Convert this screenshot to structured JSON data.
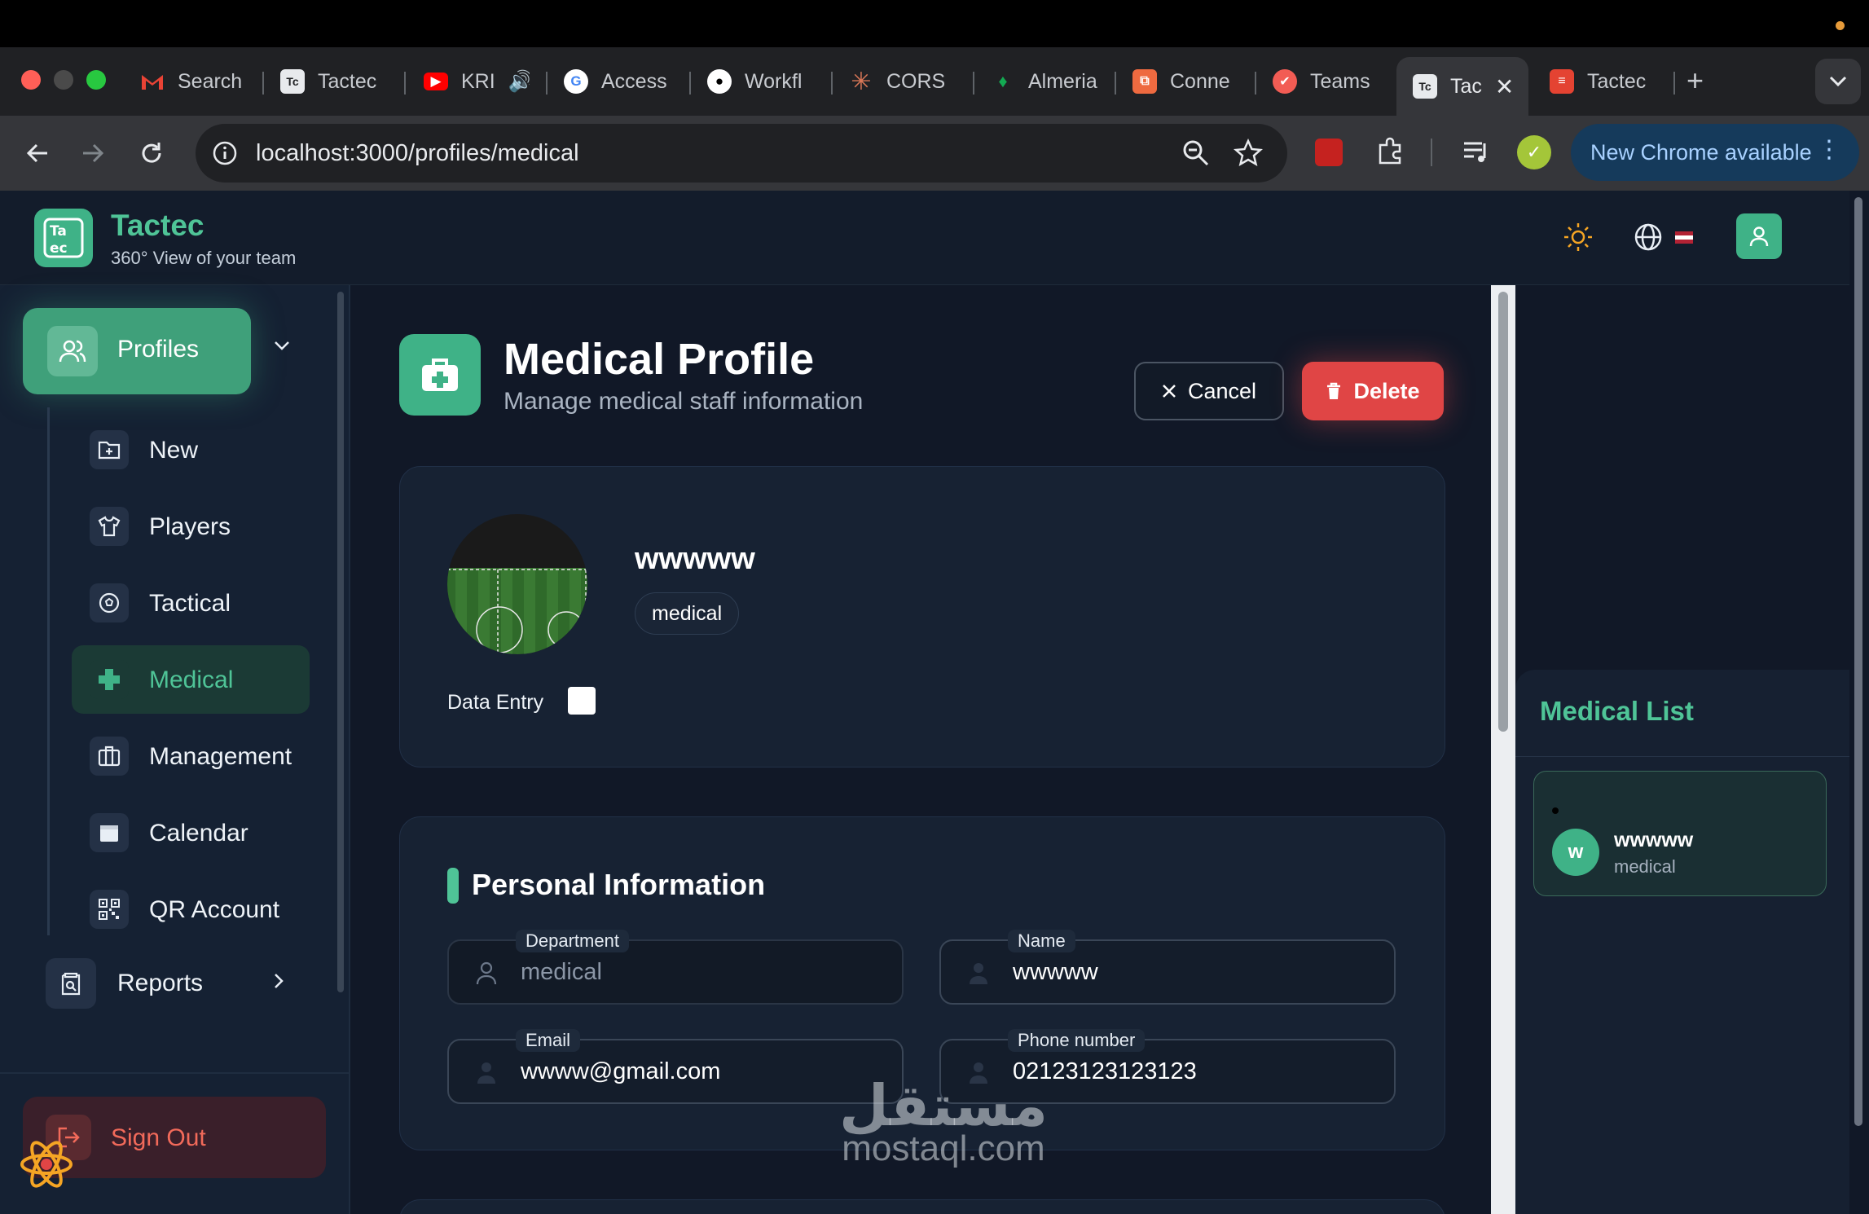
{
  "browser": {
    "tabs": [
      {
        "label": "Search",
        "icon": "gmail-icon",
        "color": "#ea4335"
      },
      {
        "label": "Tactec",
        "icon": "tactec-icon",
        "color": "#3c4043"
      },
      {
        "label": "KRI",
        "icon": "youtube-icon",
        "color": "#ff0000"
      },
      {
        "label": "Access",
        "icon": "google-icon",
        "color": "#ffffff"
      },
      {
        "label": "Workfl",
        "icon": "github-icon",
        "color": "#ffffff"
      },
      {
        "label": "CORS",
        "icon": "claude-icon",
        "color": "#d97757"
      },
      {
        "label": "Almeria",
        "icon": "mongodb-icon",
        "color": "#13aa52"
      },
      {
        "label": "Conne",
        "icon": "connect-icon",
        "color": "#ee6a40"
      },
      {
        "label": "Teams",
        "icon": "teams-icon",
        "color": "#f25c54"
      },
      {
        "label": "Tac",
        "icon": "tactec-icon",
        "color": "#3c4043"
      },
      {
        "label": "Tactec",
        "icon": "todoist-icon",
        "color": "#e44332"
      }
    ],
    "active_tab_index": 9,
    "url": "localhost:3000/profiles/medical",
    "update_button": "New Chrome available"
  },
  "app": {
    "brand": "Tactec",
    "tagline": "360° View of your team",
    "logo_text": "Tactec"
  },
  "sidebar": {
    "profiles_label": "Profiles",
    "items": [
      {
        "label": "New",
        "icon": "new-folder-icon"
      },
      {
        "label": "Players",
        "icon": "shirt-icon"
      },
      {
        "label": "Tactical",
        "icon": "soccer-ball-icon"
      },
      {
        "label": "Medical",
        "icon": "medical-cross-icon",
        "active": true
      },
      {
        "label": "Management",
        "icon": "briefcase-icon"
      },
      {
        "label": "Calendar",
        "icon": "calendar-icon"
      },
      {
        "label": "QR Account",
        "icon": "qr-code-icon"
      }
    ],
    "reports_label": "Reports",
    "signout_label": "Sign Out"
  },
  "page": {
    "title": "Medical Profile",
    "subtitle": "Manage medical staff information",
    "cancel_label": "Cancel",
    "delete_label": "Delete"
  },
  "profile": {
    "name": "wwwww",
    "role": "medical",
    "data_entry_label": "Data Entry",
    "data_entry_checked": false
  },
  "personal_info": {
    "title": "Personal Information",
    "fields": {
      "department": {
        "label": "Department",
        "value": "medical"
      },
      "name": {
        "label": "Name",
        "value": "wwwww"
      },
      "email": {
        "label": "Email",
        "value": "wwww@gmail.com"
      },
      "phone": {
        "label": "Phone number",
        "value": "02123123123123"
      }
    }
  },
  "medical_list": {
    "title": "Medical List",
    "items": [
      {
        "initial": "w",
        "name": "wwwww",
        "role": "medical"
      }
    ]
  },
  "watermark": {
    "arabic": "مستقل",
    "latin": "mostaql.com"
  },
  "colors": {
    "accent": "#3fb287",
    "danger": "#e04545",
    "bg": "#111827"
  }
}
